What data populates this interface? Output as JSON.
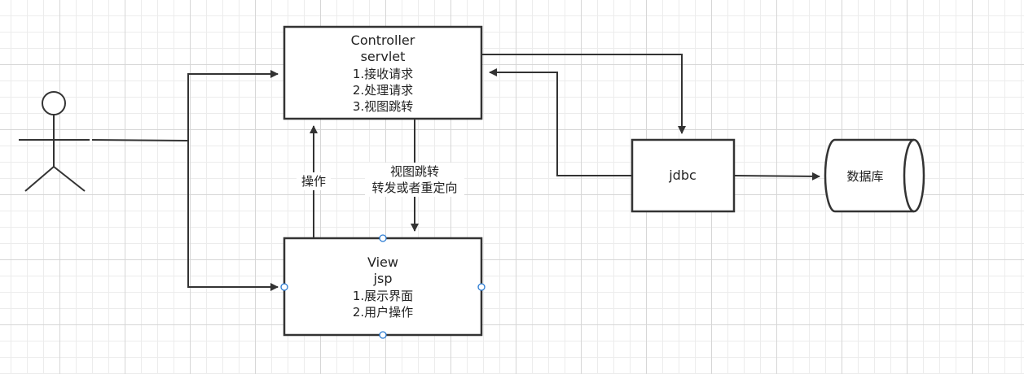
{
  "controller": {
    "title": "Controller",
    "subtitle": "servlet",
    "lines": [
      "1.接收请求",
      "2.处理请求",
      "3.视图跳转"
    ]
  },
  "view": {
    "title": "View",
    "subtitle": "jsp",
    "lines": [
      "1.展示界面",
      "2.用户操作"
    ]
  },
  "jdbc": {
    "label": "jdbc"
  },
  "database": {
    "label": "数据库"
  },
  "edges": {
    "operate": "操作",
    "view_jump": "视图跳转",
    "forward_redirect": "转发或者重定向"
  }
}
